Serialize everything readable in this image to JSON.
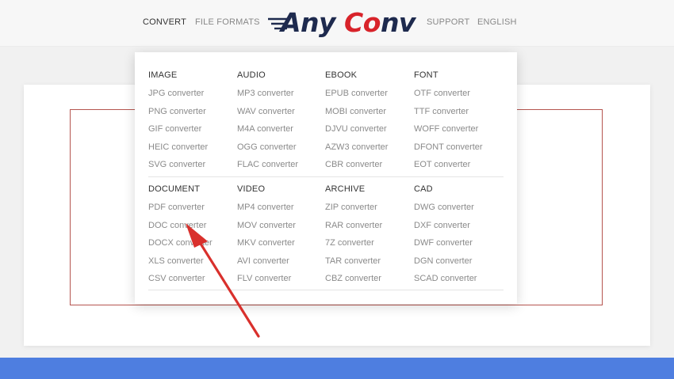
{
  "nav": {
    "convert": "CONVERT",
    "file_formats": "FILE FORMATS",
    "support": "SUPPORT",
    "language": "ENGLISH"
  },
  "logo": {
    "text_any": "Any",
    "text_c": "C",
    "text_o": "o",
    "text_nv": "nv",
    "colors": {
      "navy": "#1e2a4e",
      "red": "#d8232a"
    }
  },
  "menu": {
    "sections_top": [
      {
        "title": "IMAGE",
        "items": [
          "JPG converter",
          "PNG converter",
          "GIF converter",
          "HEIC converter",
          "SVG converter"
        ]
      },
      {
        "title": "AUDIO",
        "items": [
          "MP3 converter",
          "WAV converter",
          "M4A converter",
          "OGG converter",
          "FLAC converter"
        ]
      },
      {
        "title": "EBOOK",
        "items": [
          "EPUB converter",
          "MOBI converter",
          "DJVU converter",
          "AZW3 converter",
          "CBR converter"
        ]
      },
      {
        "title": "FONT",
        "items": [
          "OTF converter",
          "TTF converter",
          "WOFF converter",
          "DFONT converter",
          "EOT converter"
        ]
      }
    ],
    "sections_bottom": [
      {
        "title": "DOCUMENT",
        "items": [
          "PDF converter",
          "DOC converter",
          "DOCX converter",
          "XLS converter",
          "CSV converter"
        ]
      },
      {
        "title": "VIDEO",
        "items": [
          "MP4 converter",
          "MOV converter",
          "MKV converter",
          "AVI converter",
          "FLV converter"
        ]
      },
      {
        "title": "ARCHIVE",
        "items": [
          "ZIP converter",
          "RAR converter",
          "7Z converter",
          "TAR converter",
          "CBZ converter"
        ]
      },
      {
        "title": "CAD",
        "items": [
          "DWG converter",
          "DXF converter",
          "DWF converter",
          "DGN converter",
          "SCAD converter"
        ]
      }
    ]
  },
  "annotation": {
    "arrow_color": "#d9302c",
    "target": "DOC converter"
  },
  "colors": {
    "footer_bar": "#4e7ee0",
    "dropzone_border": "#b5554f"
  }
}
